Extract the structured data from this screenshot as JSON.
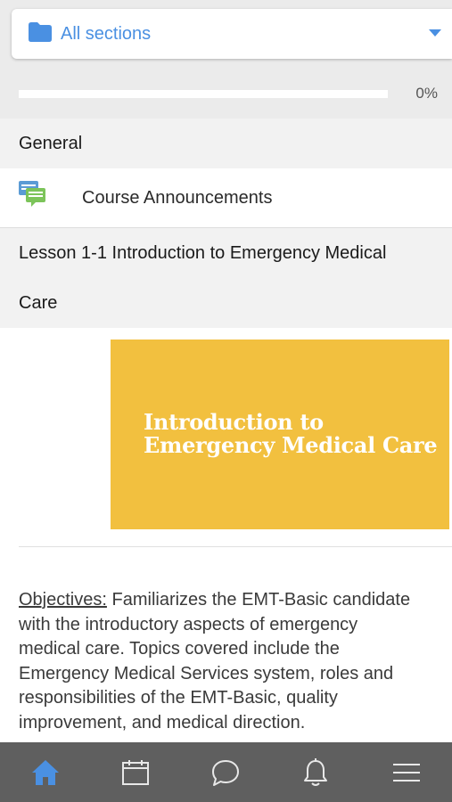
{
  "section_selector": {
    "label": "All sections",
    "icon": "folder-icon",
    "caret_icon": "chevron-down-icon"
  },
  "progress": {
    "value": 0,
    "label": "0%"
  },
  "sections": {
    "general": {
      "title": "General",
      "items": [
        {
          "label": "Course Announcements",
          "icon": "forum-icon"
        }
      ]
    },
    "lesson": {
      "title": "Lesson 1-1 Introduction to Emergency Medical Care",
      "banner": {
        "line1": "Introduction to",
        "line2": "Emergency Medical Care"
      },
      "objectives_label": "Objectives:",
      "objectives_text": " Familiarizes the EMT-Basic candidate with the introductory aspects of emergency medical care. Topics covered include the Emergency Medical Services system, roles and responsibilities of the EMT-Basic, quality improvement, and medical direction."
    }
  },
  "tab_bar": [
    {
      "name": "home-tab",
      "icon": "home-icon",
      "active": true
    },
    {
      "name": "calendar-tab",
      "icon": "calendar-icon",
      "active": false
    },
    {
      "name": "messages-tab",
      "icon": "chat-bubble-icon",
      "active": false
    },
    {
      "name": "notifications-tab",
      "icon": "bell-icon",
      "active": false
    },
    {
      "name": "more-tab",
      "icon": "menu-icon",
      "active": false
    }
  ],
  "colors": {
    "accent": "#4a90e2",
    "banner": "#f2c03f",
    "tab_bar": "#5f5f5f",
    "tab_icon": "#e8e8e8"
  }
}
